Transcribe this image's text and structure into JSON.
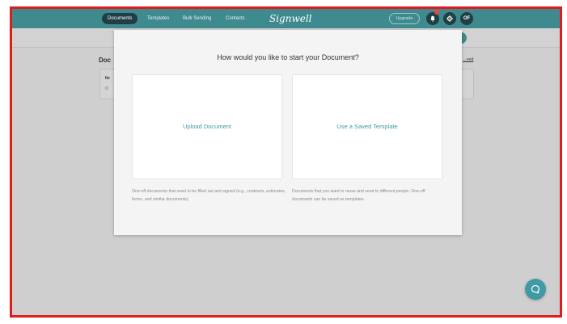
{
  "nav": {
    "items": [
      {
        "label": "Documents",
        "active": true
      },
      {
        "label": "Templates",
        "active": false
      },
      {
        "label": "Bulk Sending",
        "active": false
      },
      {
        "label": "Contacts",
        "active": false
      }
    ],
    "logo": "Signwell",
    "upgrade_label": "Upgrade",
    "avatar_initials": "OF",
    "icons": [
      "bell-icon",
      "gear-icon"
    ],
    "notification": true
  },
  "background_page": {
    "heading": "Doc",
    "link": "...ved",
    "card_line1": "Ite",
    "card_line2": "O"
  },
  "modal": {
    "title": "How would you like to start your Document?",
    "options": [
      {
        "label": "Upload Document",
        "description": "One-off documents that need to be filled out and signed (e.g., contracts, estimates, forms, and similar documents)."
      },
      {
        "label": "Use a Saved Template",
        "description": "Documents that you want to reuse and send to different people. One-off documents can be saved as templates."
      }
    ]
  },
  "chat": {
    "icon": "chat-bubble-icon"
  },
  "colors": {
    "topbar": "#3f8a8f",
    "accent": "#3f9aa4",
    "active_nav": "#1f3f45",
    "frame_border": "#e01b1b",
    "overlay": "#cfcfcf"
  }
}
